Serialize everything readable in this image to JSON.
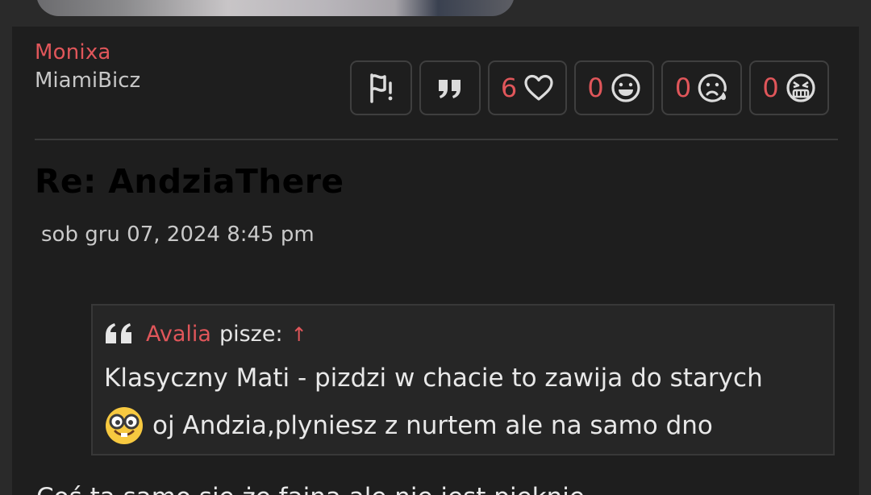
{
  "post": {
    "username": "Monixa",
    "rank": "MiamiBicz",
    "title": "Re: AndziaThere",
    "date": "sob gru 07, 2024 8:45 pm"
  },
  "actions": {
    "report_icon": "flag-icon",
    "quote_icon": "quote-icon",
    "reactions": [
      {
        "count": "6",
        "icon": "heart-icon"
      },
      {
        "count": "0",
        "icon": "smile-icon"
      },
      {
        "count": "0",
        "icon": "sad-icon"
      },
      {
        "count": "0",
        "icon": "angry-icon"
      }
    ]
  },
  "quote": {
    "author": "Avalia",
    "says": "pisze:",
    "arrow": "↑",
    "line1": "Klasyczny Mati - pizdzi w chacie to zawija do starych",
    "line2": "oj Andzia,plyniesz z nurtem ale na samo dno",
    "emoji": "nerd-face-icon"
  },
  "body": {
    "cut_line": "Coś ta samo się że fajna ale nie jest pięknie"
  },
  "colors": {
    "accent": "#e0565a",
    "panel": "#1e1e1e",
    "background": "#2a2a2a"
  }
}
